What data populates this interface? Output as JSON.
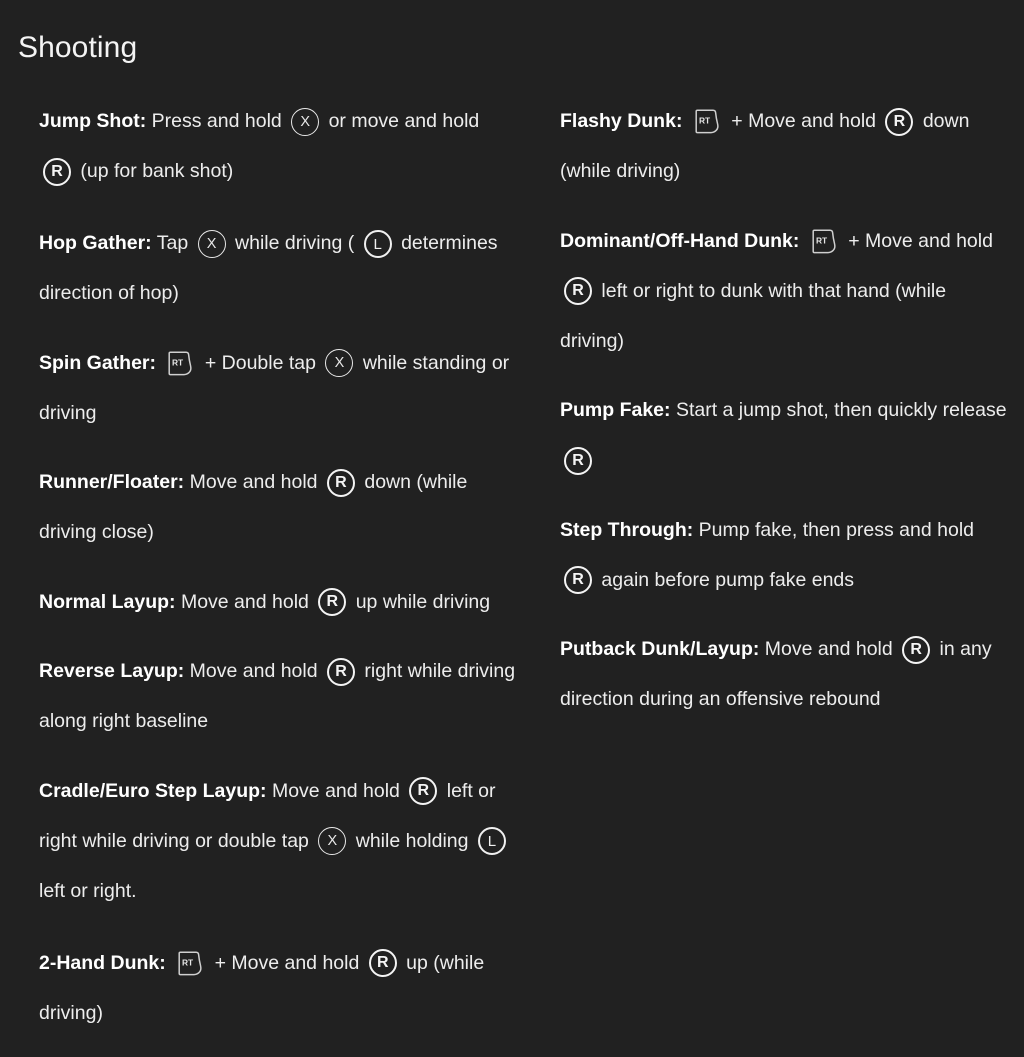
{
  "page": {
    "title": "Shooting",
    "background_color": "#212121",
    "text_color": "#ededed"
  },
  "buttons": {
    "x": {
      "icon": "xbox-x-button-icon",
      "label": "X"
    },
    "l": {
      "icon": "xbox-left-stick-button-icon",
      "label": "L"
    },
    "r": {
      "icon": "xbox-right-stick-button-icon",
      "label": "R"
    },
    "rt": {
      "icon": "xbox-right-trigger-icon",
      "label": "RT"
    }
  },
  "columns": {
    "left": [
      {
        "id": "jump-shot",
        "term": "Jump Shot:",
        "parts": [
          {
            "type": "text",
            "value": " Press and hold "
          },
          {
            "type": "button",
            "value": "x"
          },
          {
            "type": "text",
            "value": " or move and hold "
          },
          {
            "type": "button",
            "value": "r"
          },
          {
            "type": "text",
            "value": " (up for bank shot)"
          }
        ],
        "plain": "Jump Shot: Press and hold (X) or move and hold (R) (up for bank shot)"
      },
      {
        "id": "hop-gather",
        "term": "Hop Gather:",
        "parts": [
          {
            "type": "text",
            "value": " Tap "
          },
          {
            "type": "button",
            "value": "x"
          },
          {
            "type": "text",
            "value": " while driving ( "
          },
          {
            "type": "button",
            "value": "l"
          },
          {
            "type": "text",
            "value": " determines direction of hop)"
          }
        ],
        "plain": "Hop Gather: Tap (X) while driving ( (L) determines direction of hop)"
      },
      {
        "id": "spin-gather",
        "term": "Spin Gather:",
        "parts": [
          {
            "type": "text",
            "value": " "
          },
          {
            "type": "button",
            "value": "rt"
          },
          {
            "type": "text",
            "value": " + Double tap "
          },
          {
            "type": "button",
            "value": "x"
          },
          {
            "type": "text",
            "value": " while standing or driving"
          }
        ],
        "plain": "Spin Gather: [RT] + Double tap (X) while standing or driving"
      },
      {
        "id": "runner-floater",
        "term": "Runner/Floater:",
        "parts": [
          {
            "type": "text",
            "value": " Move and hold "
          },
          {
            "type": "button",
            "value": "r"
          },
          {
            "type": "text",
            "value": " down (while driving close)"
          }
        ],
        "plain": "Runner/Floater: Move and hold (R) down (while driving close)"
      },
      {
        "id": "normal-layup",
        "term": "Normal Layup:",
        "parts": [
          {
            "type": "text",
            "value": " Move and hold "
          },
          {
            "type": "button",
            "value": "r"
          },
          {
            "type": "text",
            "value": " up while driving"
          }
        ],
        "plain": "Normal Layup: Move and hold (R) up while driving"
      },
      {
        "id": "reverse-layup",
        "term": "Reverse Layup:",
        "parts": [
          {
            "type": "text",
            "value": " Move and hold "
          },
          {
            "type": "button",
            "value": "r"
          },
          {
            "type": "text",
            "value": " right while driving along right baseline"
          }
        ],
        "plain": "Reverse Layup: Move and hold (R) right while driving along right baseline"
      },
      {
        "id": "cradle-euro-step-layup",
        "term": "Cradle/Euro Step Layup:",
        "parts": [
          {
            "type": "text",
            "value": " Move and hold "
          },
          {
            "type": "button",
            "value": "r"
          },
          {
            "type": "text",
            "value": " left or right while driving or double tap "
          },
          {
            "type": "button",
            "value": "x"
          },
          {
            "type": "text",
            "value": " while holding "
          },
          {
            "type": "button",
            "value": "l"
          },
          {
            "type": "text",
            "value": " left or right."
          }
        ],
        "plain": "Cradle/Euro Step Layup: Move and hold (R) left or right while driving or double tap (X) while holding (L) left or right."
      },
      {
        "id": "2-hand-dunk",
        "term": "2-Hand Dunk:",
        "parts": [
          {
            "type": "text",
            "value": " "
          },
          {
            "type": "button",
            "value": "rt"
          },
          {
            "type": "text",
            "value": " + Move and hold "
          },
          {
            "type": "button",
            "value": "r"
          },
          {
            "type": "text",
            "value": " up (while driving)"
          }
        ],
        "plain": "2-Hand Dunk: [RT] + Move and hold (R) up (while driving)"
      }
    ],
    "right": [
      {
        "id": "flashy-dunk",
        "term": "Flashy Dunk:",
        "parts": [
          {
            "type": "text",
            "value": " "
          },
          {
            "type": "button",
            "value": "rt"
          },
          {
            "type": "text",
            "value": " + Move and hold "
          },
          {
            "type": "button",
            "value": "r"
          },
          {
            "type": "text",
            "value": " down (while driving)"
          }
        ],
        "plain": "Flashy Dunk: [RT] + Move and hold (R) down (while driving)"
      },
      {
        "id": "dominant-off-hand-dunk",
        "term": "Dominant/Off-Hand Dunk:",
        "parts": [
          {
            "type": "text",
            "value": " "
          },
          {
            "type": "button",
            "value": "rt"
          },
          {
            "type": "text",
            "value": " + Move and hold "
          },
          {
            "type": "button",
            "value": "r"
          },
          {
            "type": "text",
            "value": " left or right to dunk with that hand (while driving)"
          }
        ],
        "plain": "Dominant/Off-Hand Dunk: [RT] + Move and hold (R) left or right to dunk with that hand (while driving)"
      },
      {
        "id": "pump-fake",
        "term": "Pump Fake:",
        "parts": [
          {
            "type": "text",
            "value": " Start a jump shot, then quickly release "
          },
          {
            "type": "button",
            "value": "r"
          }
        ],
        "plain": "Pump Fake: Start a jump shot, then quickly release (R)"
      },
      {
        "id": "step-through",
        "term": "Step Through:",
        "parts": [
          {
            "type": "text",
            "value": " Pump fake, then press and hold "
          },
          {
            "type": "button",
            "value": "r"
          },
          {
            "type": "text",
            "value": " again before pump fake ends"
          }
        ],
        "plain": "Step Through: Pump fake, then press and hold (R) again before pump fake ends"
      },
      {
        "id": "putback-dunk-layup",
        "term": "Putback Dunk/Layup:",
        "parts": [
          {
            "type": "text",
            "value": " Move and hold "
          },
          {
            "type": "button",
            "value": "r"
          },
          {
            "type": "text",
            "value": " in any direction during an offensive rebound"
          }
        ],
        "plain": "Putback Dunk/Layup: Move and hold (R) in any direction during an offensive rebound"
      }
    ]
  }
}
